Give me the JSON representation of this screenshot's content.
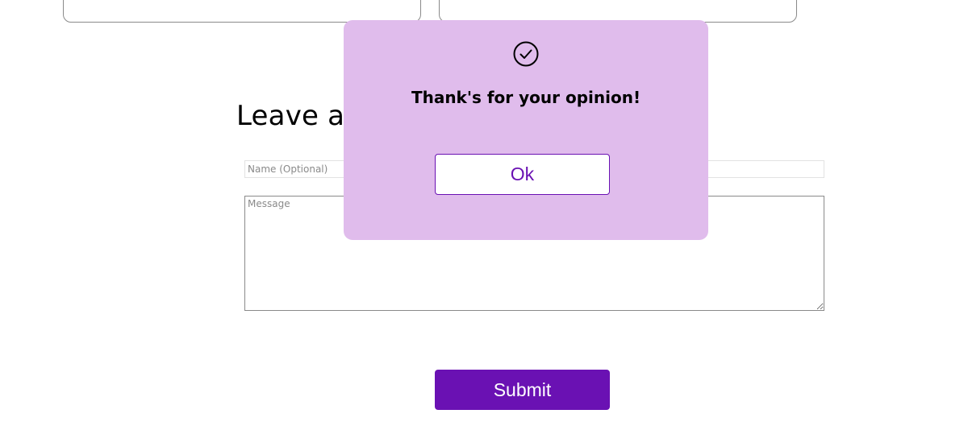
{
  "feedback_form": {
    "title": "Leave a Message",
    "name_placeholder": "Name (Optional)",
    "message_placeholder": "Message",
    "submit_label": "Submit"
  },
  "dialog": {
    "icon": "check-circle-icon",
    "message": "Thank's for your opinion!",
    "ok_label": "Ok"
  },
  "colors": {
    "accent": "#6a11b3",
    "dialog_background": "#e0bcec"
  }
}
